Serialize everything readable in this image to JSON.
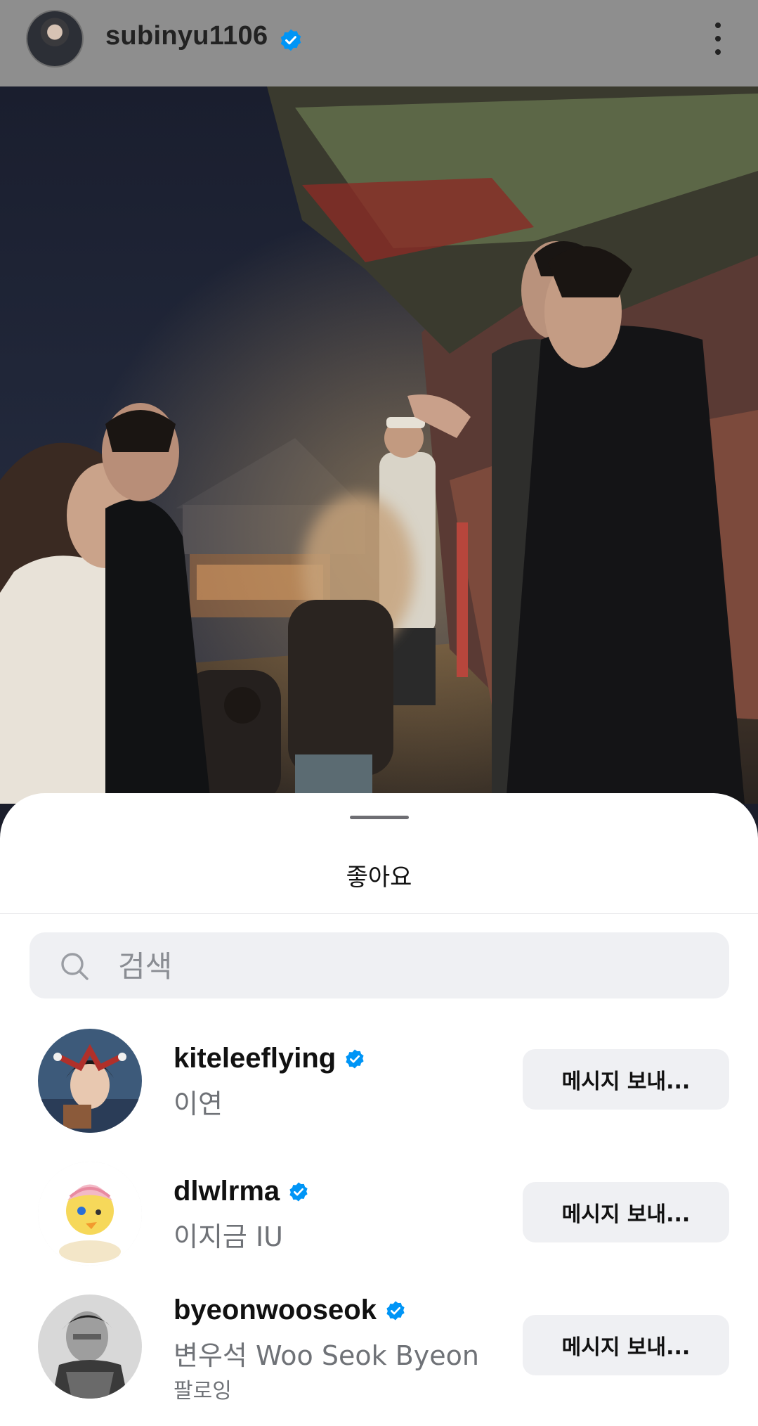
{
  "header": {
    "username": "subinyu1106",
    "verified": true,
    "avatar": "profile-photo",
    "menu_icon": "more-vertical-icon"
  },
  "post": {
    "image": "night palace photo with people"
  },
  "likes_sheet": {
    "title": "좋아요",
    "search": {
      "placeholder": "검색",
      "value": "",
      "icon": "search-icon"
    },
    "users": [
      {
        "username": "kiteleeflying",
        "verified": true,
        "full_name": "이연",
        "extra": "",
        "button": "메시지 보내..."
      },
      {
        "username": "dlwlrma",
        "verified": true,
        "full_name": "이지금 IU",
        "extra": "",
        "button": "메시지 보내..."
      },
      {
        "username": "byeonwooseok",
        "verified": true,
        "full_name": "변우석  Woo Seok Byeon",
        "extra": "팔로잉",
        "button": "메시지 보내..."
      }
    ]
  },
  "colors": {
    "verified_blue": "#0095f6",
    "sheet_bg": "#ffffff",
    "button_bg": "#eff0f3",
    "header_bg": "#8e8e8e"
  }
}
